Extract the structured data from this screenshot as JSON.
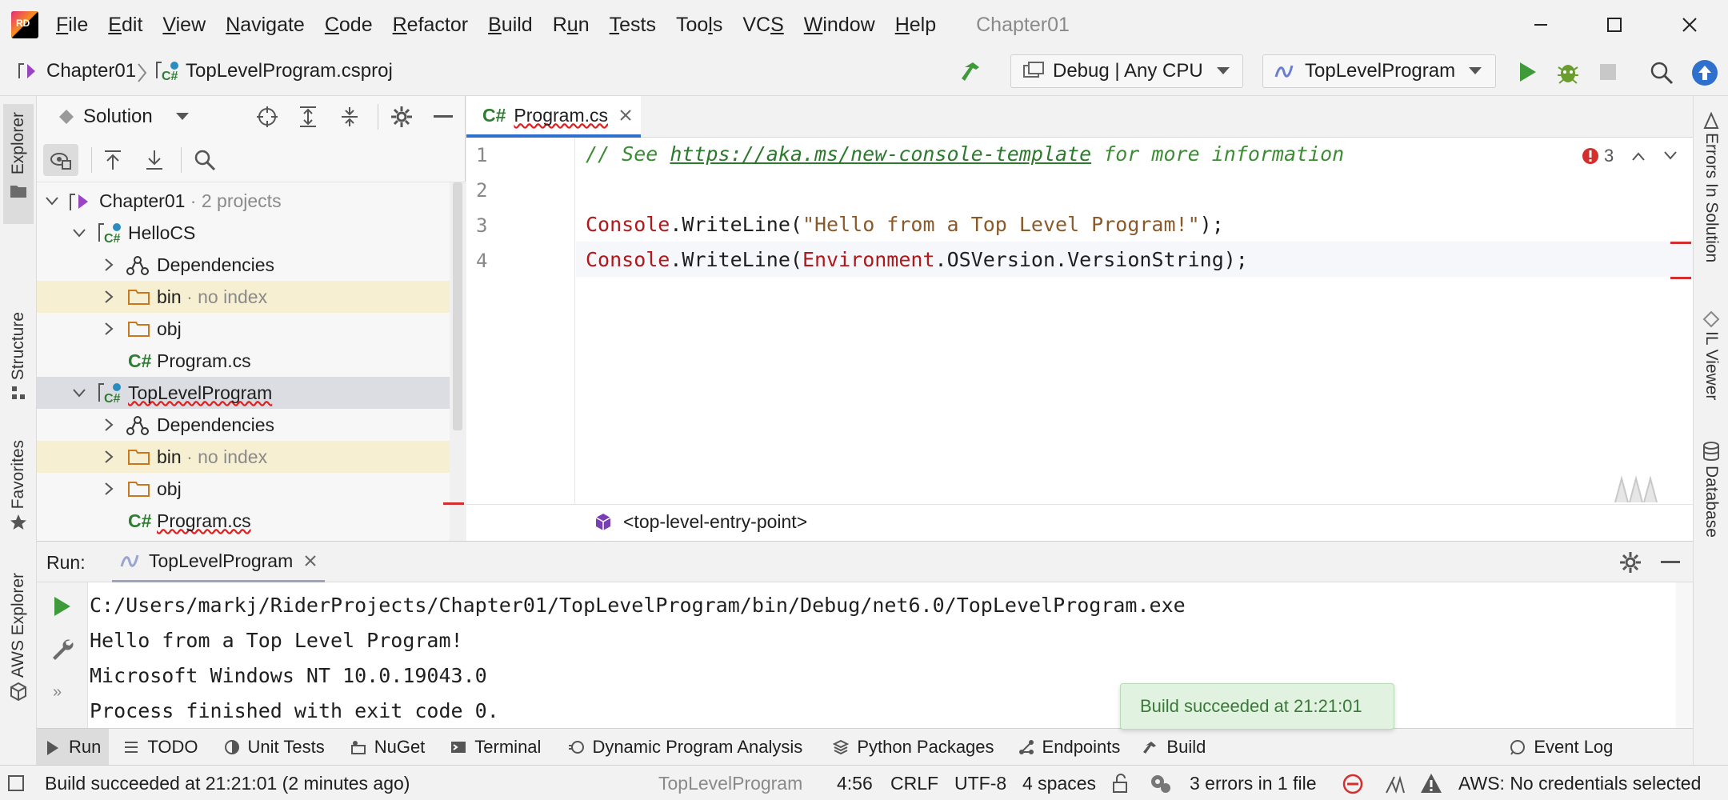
{
  "app": {
    "logo_text": "RD",
    "title": "Chapter01",
    "menu": [
      {
        "pre": "",
        "u": "F",
        "post": "ile"
      },
      {
        "pre": "",
        "u": "E",
        "post": "dit"
      },
      {
        "pre": "",
        "u": "V",
        "post": "iew"
      },
      {
        "pre": "",
        "u": "N",
        "post": "avigate"
      },
      {
        "pre": "",
        "u": "C",
        "post": "ode"
      },
      {
        "pre": "",
        "u": "R",
        "post": "efactor"
      },
      {
        "pre": "",
        "u": "B",
        "post": "uild"
      },
      {
        "pre": "R",
        "u": "u",
        "post": "n"
      },
      {
        "pre": "",
        "u": "T",
        "post": "ests"
      },
      {
        "pre": "Too",
        "u": "l",
        "post": "s"
      },
      {
        "pre": "VC",
        "u": "S",
        "post": ""
      },
      {
        "pre": "",
        "u": "W",
        "post": "indow"
      },
      {
        "pre": "",
        "u": "H",
        "post": "elp"
      }
    ]
  },
  "toolbar": {
    "breadcrumb_solution": "Chapter01",
    "breadcrumb_project": "TopLevelProgram.csproj",
    "config": "Debug | Any CPU",
    "run_config": "TopLevelProgram"
  },
  "left_strip": {
    "explorer": "Explorer",
    "structure": "Structure",
    "favorites": "Favorites",
    "aws": "AWS Explorer"
  },
  "right_strip": {
    "errors": "Errors In Solution",
    "il": "IL Viewer",
    "db": "Database"
  },
  "explorer": {
    "mode": "Solution",
    "solution_name": "Chapter01",
    "solution_meta": " · 2 projects",
    "projects": [
      {
        "name": "HelloCS",
        "deps": "Dependencies",
        "bin": "bin",
        "bin_meta": " · no index",
        "obj": "obj",
        "file": "Program.cs",
        "cs": "C#"
      },
      {
        "name": "TopLevelProgram",
        "deps": "Dependencies",
        "bin": "bin",
        "bin_meta": " · no index",
        "obj": "obj",
        "file": "Program.cs",
        "cs": "C#"
      }
    ]
  },
  "editor": {
    "tab_label": "Program.cs",
    "tab_lang": "C#",
    "error_count": "3",
    "line_numbers": [
      "1",
      "2",
      "3",
      "4"
    ],
    "line1_pre": "// See ",
    "line1_link": "https://aka.ms/new-console-template",
    "line1_post": " for more information",
    "line3_type": "Console",
    "line3_method": ".WriteLine(",
    "line3_str": "\"Hello from a Top Level Program!\"",
    "line3_end": ");",
    "line4_type": "Console",
    "line4_method": ".WriteLine(",
    "line4_type2": "Environment",
    "line4_end": ".OSVersion.VersionString);",
    "breadcrumb": "<top-level-entry-point>"
  },
  "run": {
    "label": "Run:",
    "tab": "TopLevelProgram",
    "output": [
      "C:/Users/markj/RiderProjects/Chapter01/TopLevelProgram/bin/Debug/net6.0/TopLevelProgram.exe",
      "Hello from a Top Level Program!",
      "Microsoft Windows NT 10.0.19043.0",
      "Process finished with exit code 0."
    ]
  },
  "tool_tabs": [
    "Run",
    "TODO",
    "Unit Tests",
    "NuGet",
    "Terminal",
    "Dynamic Program Analysis",
    "Python Packages",
    "Endpoints",
    "Build",
    "Event Log"
  ],
  "toast": "Build succeeded at 21:21:01",
  "status": {
    "message": "Build succeeded at 21:21:01 (2 minutes ago)",
    "project": "TopLevelProgram",
    "position": "4:56",
    "line_ending": "CRLF",
    "encoding": "UTF-8",
    "indent": "4 spaces",
    "errors": "3 errors in 1 file",
    "aws": "AWS: No credentials selected"
  },
  "colors": {
    "accent_blue": "#2f6fce",
    "run_green": "#3f9b3a",
    "error_red": "#d32f2f",
    "folder_orange": "#c9781e"
  }
}
